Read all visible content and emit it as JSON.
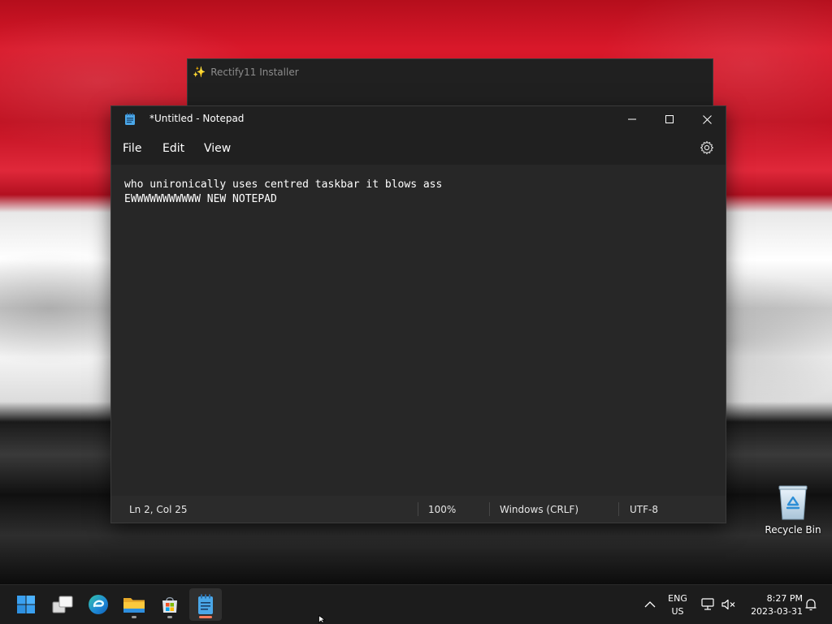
{
  "installer": {
    "title": "Rectify11 Installer",
    "icon": "sparkle-icon"
  },
  "notepad": {
    "title": "*Untitled - Notepad",
    "menu": [
      "File",
      "Edit",
      "View"
    ],
    "content": [
      "who unironically uses centred taskbar it blows ass",
      "EWWWWWWWWWWW NEW NOTEPAD"
    ],
    "status": {
      "position": "Ln 2, Col 25",
      "zoom": "100%",
      "line_ending": "Windows (CRLF)",
      "encoding": "UTF-8"
    }
  },
  "desktop": {
    "recycle_bin_label": "Recycle Bin"
  },
  "taskbar": {
    "apps": [
      "start-icon",
      "task-view-icon",
      "edge-icon",
      "file-explorer-icon",
      "microsoft-store-icon",
      "notepad-icon"
    ],
    "lang_line1": "ENG",
    "lang_line2": "US",
    "time": "8:27 PM",
    "date": "2023-03-31"
  },
  "colors": {
    "accent": "#ff7b5a",
    "titlebar": "#202020",
    "editor_bg": "#272727"
  }
}
